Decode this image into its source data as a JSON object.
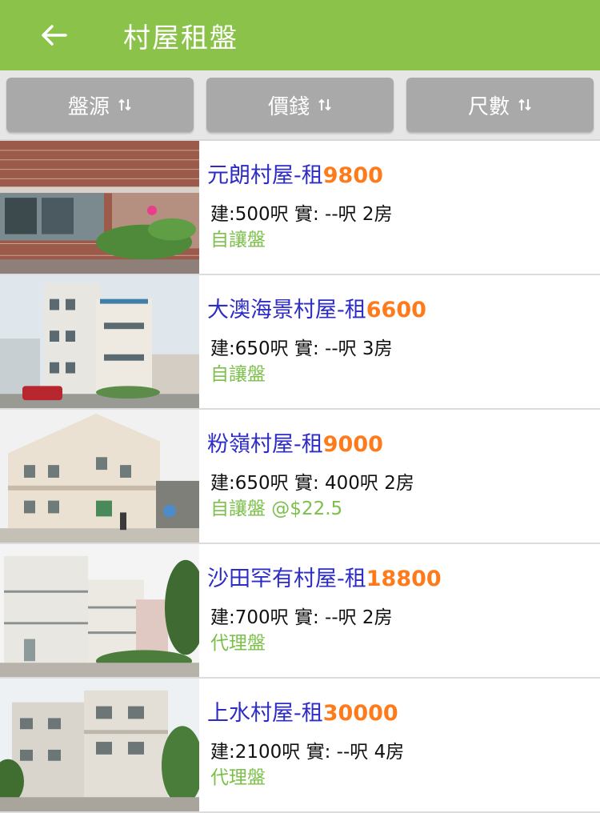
{
  "app": {
    "title": "村屋租盤",
    "accent": "#8bc34a"
  },
  "filters": [
    {
      "label": "盤源",
      "icon": "sort-icon"
    },
    {
      "label": "價錢",
      "icon": "sort-icon"
    },
    {
      "label": "尺數",
      "icon": "sort-icon"
    }
  ],
  "listings": [
    {
      "name": "元朗村屋-租",
      "price": "9800",
      "specs": "建:500呎 實: --呎 2房",
      "source": "自讓盤"
    },
    {
      "name": "大澳海景村屋-租",
      "price": "6600",
      "specs": "建:650呎 實: --呎 3房",
      "source": "自讓盤"
    },
    {
      "name": "粉嶺村屋-租",
      "price": "9000",
      "specs": "建:650呎 實: 400呎 2房",
      "source": "自讓盤 @$22.5"
    },
    {
      "name": "沙田罕有村屋-租",
      "price": "18800",
      "specs": "建:700呎 實: --呎 2房",
      "source": "代理盤"
    },
    {
      "name": "上水村屋-租",
      "price": "30000",
      "specs": "建:2100呎 實: --呎 4房",
      "source": "代理盤"
    }
  ]
}
